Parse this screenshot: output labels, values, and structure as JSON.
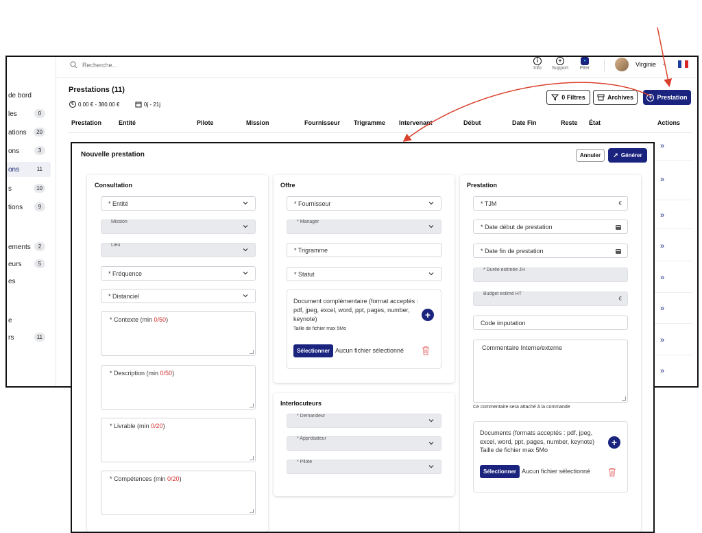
{
  "topbar": {
    "search_placeholder": "Recherche...",
    "icons": [
      {
        "label": "Info",
        "icon": "info-icon"
      },
      {
        "label": "Support",
        "icon": "lifebuoy-icon"
      },
      {
        "label": "Piter",
        "icon": "chat-icon"
      }
    ],
    "user_name": "Virginie",
    "flag": "french-flag-icon"
  },
  "sidebar": {
    "items": [
      {
        "label": "de bord",
        "badge": ""
      },
      {
        "label": "les",
        "badge": "0"
      },
      {
        "label": "ations",
        "badge": "20"
      },
      {
        "label": "ons",
        "badge": "3"
      },
      {
        "label": "ons",
        "badge": "11"
      },
      {
        "label": "s",
        "badge": "10"
      },
      {
        "label": "tions",
        "badge": "9"
      },
      {
        "label": "ements",
        "badge": "2"
      },
      {
        "label": "eurs",
        "badge": "5"
      },
      {
        "label": "es",
        "badge": ""
      },
      {
        "label": "e",
        "badge": ""
      },
      {
        "label": "rs",
        "badge": "11"
      }
    ]
  },
  "page": {
    "title": "Prestations (11)",
    "price_range": "0.00 € - 380.00 €",
    "day_range": "0j - 21j",
    "filters_label": "0 Filtres",
    "archives_label": "Archives",
    "add_label": "Prestation"
  },
  "table": {
    "columns": [
      "Prestation",
      "Entité",
      "Pilote",
      "Mission",
      "Fournisseur",
      "Trigramme",
      "Intervenant",
      "Début",
      "Date Fin",
      "Reste",
      "État",
      "Actions"
    ]
  },
  "modal": {
    "title": "Nouvelle prestation",
    "cancel_label": "Annuler",
    "generate_label": "Générer",
    "consultation": {
      "title": "Consultation",
      "entite": "* Entité",
      "mission": "Mission",
      "lieu": "Lieu",
      "frequence": "* Fréquence",
      "distanciel": "* Distanciel",
      "contexte": "* Contexte (min ",
      "contexte_count": "0/50",
      "description": "* Description (min ",
      "description_count": "0/50",
      "livrable": "* Livrable (min ",
      "livrable_count": "0/20",
      "competences": "* Compétences (min ",
      "competences_count": "0/20"
    },
    "offre": {
      "title": "Offre",
      "fournisseur": "* Fournisseur",
      "manager": "* Manager",
      "trigramme": "* Trigramme",
      "statut": "* Statut",
      "doc_text": "Document complémentaire (format acceptés : pdf, jpeg, excel, word, ppt, pages, number, keynote)",
      "doc_size": "Taille de fichier max 5Mo",
      "select_label": "Sélectionner",
      "no_file": "Aucun fichier sélectionné"
    },
    "interlocuteurs": {
      "title": "Interlocuteurs",
      "demandeur": "* Demandeur",
      "approbateur": "* Approbateur",
      "pilote": "* Pilote"
    },
    "prestation": {
      "title": "Prestation",
      "tjm": "* TJM",
      "currency": "€",
      "date_debut": "* Date début de prestation",
      "date_fin": "* Date fin de prestation",
      "duree": "* Durée estimée JH",
      "budget": "Budget estimé HT",
      "code": "Code imputation",
      "commentaire": "Commentaire Interne/externe",
      "commentaire_hint": "Ce commentaire sera attaché à la commande",
      "docs_text": "Documents (formats acceptés : pdf, jpeg, excel, word, ppt, pages, number, keynote)",
      "docs_size": "Taille de fichier max 5Mo",
      "select_label": "Sélectionner",
      "no_file": "Aucun fichier sélectionné"
    }
  },
  "colors": {
    "primary": "#1a237e",
    "arrow": "#d9402b",
    "danger": "#d32f2f"
  }
}
